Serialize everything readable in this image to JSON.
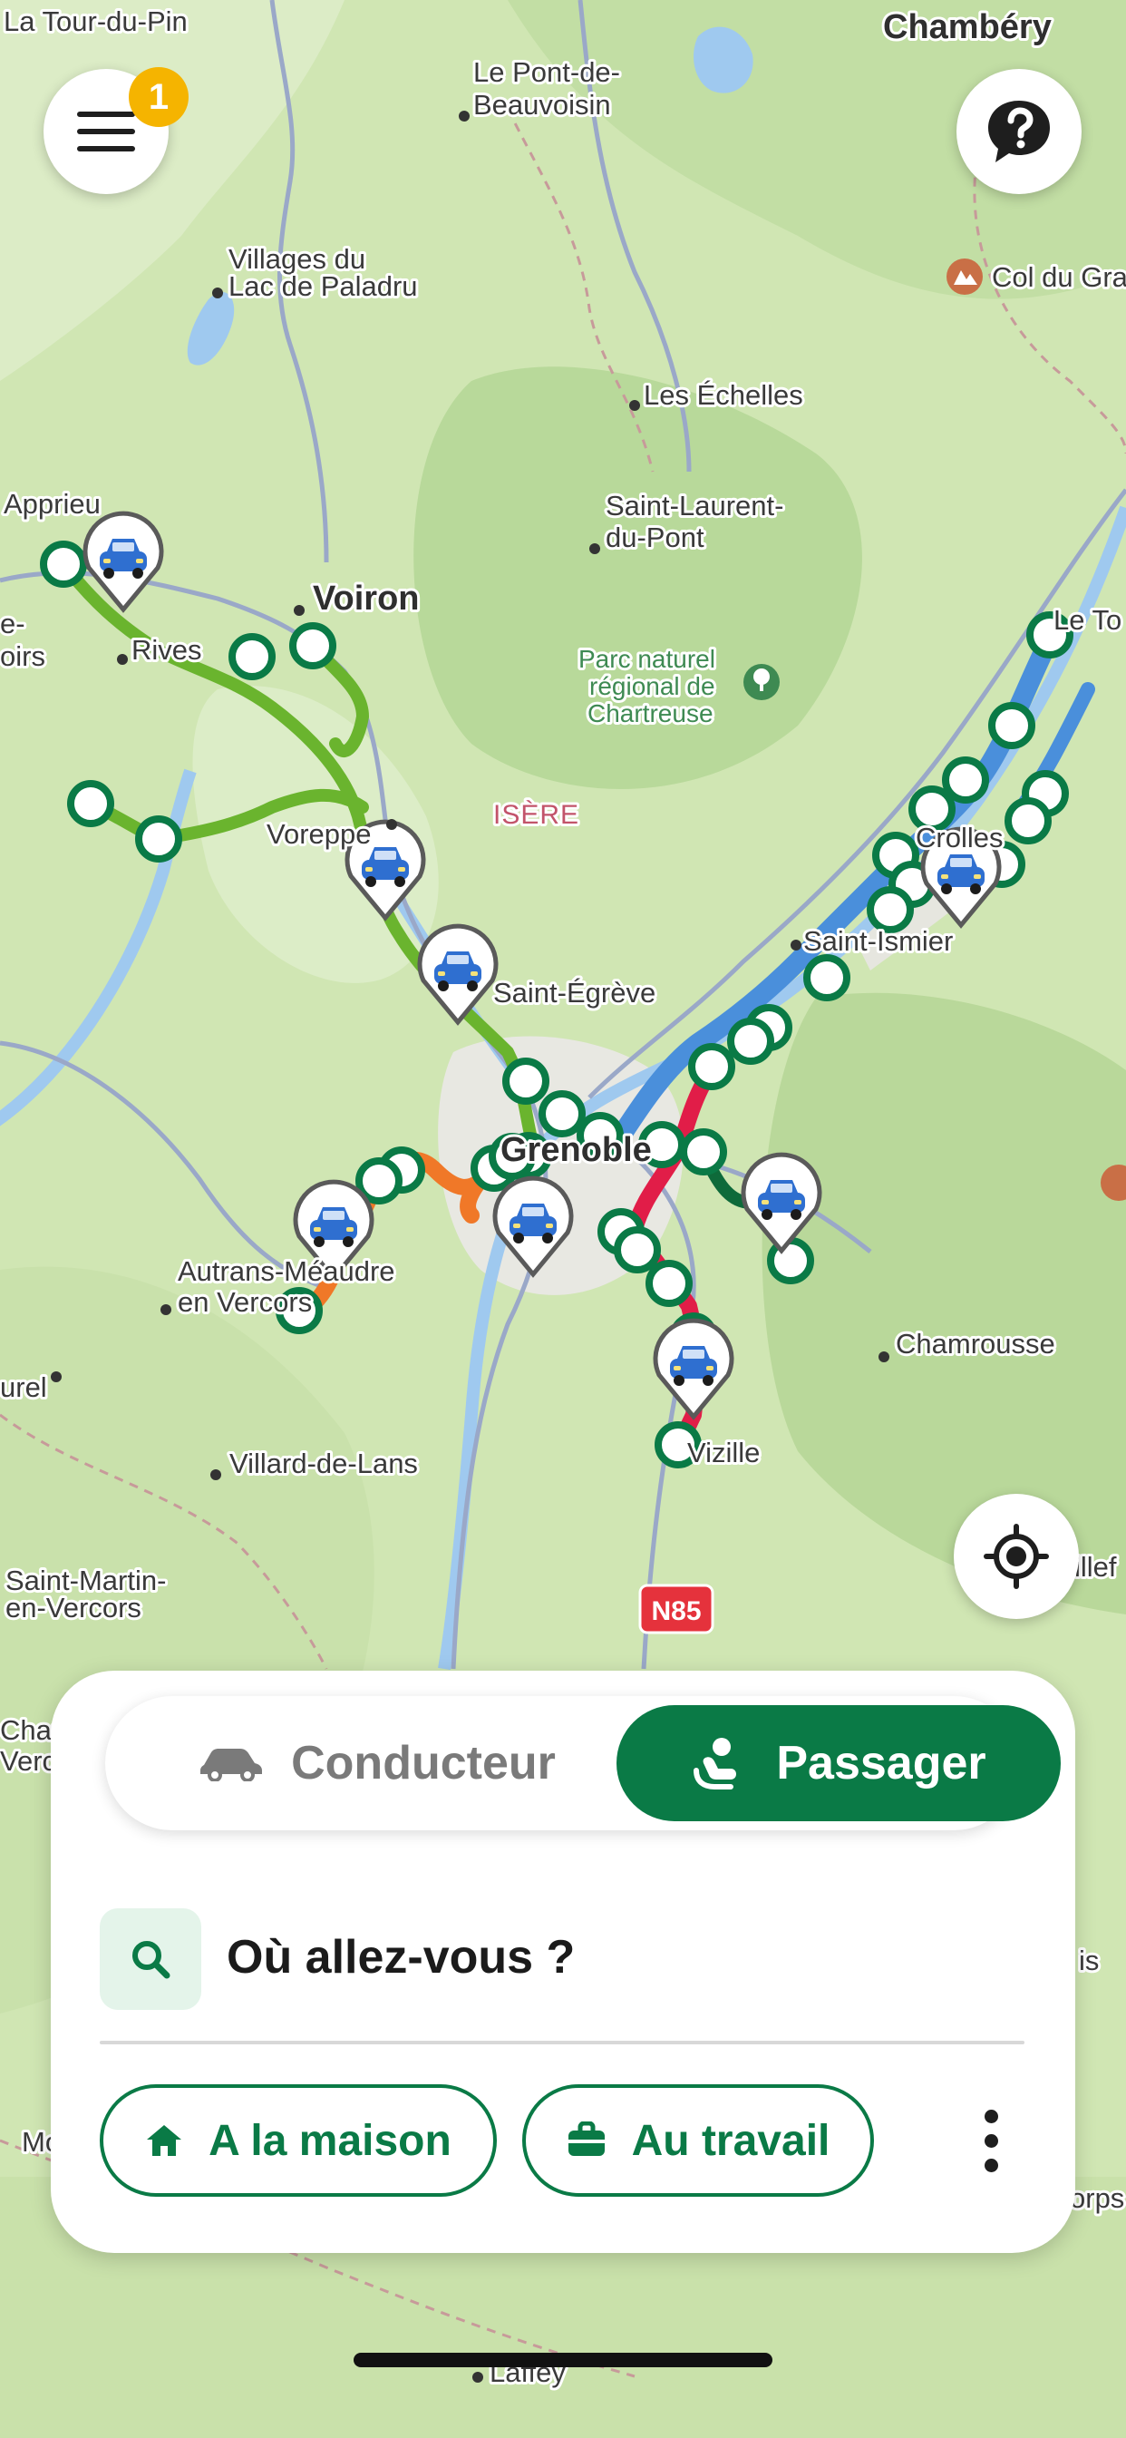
{
  "map": {
    "places": {
      "la_tour_du_pin": "La Tour-du-Pin",
      "chambery": "Chambéry",
      "pont_de_beauvoisin_1": "Le Pont-de-",
      "pont_de_beauvoisin_2": "Beauvoisin",
      "paladru_1": "Villages du",
      "paladru_2": "Lac de Paladru",
      "col_du_granier": "Col du Gra",
      "les_echelles": "Les Échelles",
      "st_laurent_1": "Saint-Laurent-",
      "st_laurent_2": "du-Pont",
      "apprieu": "Apprieu",
      "voiron": "Voiron",
      "rives": "Rives",
      "le_touvet": "Le To",
      "left_edge_1": "e-",
      "left_edge_2": "oirs",
      "chartreuse_1": "Parc naturel",
      "chartreuse_2": "régional de",
      "chartreuse_3": "Chartreuse",
      "isere": "ISÈRE",
      "voreppe": "Voreppe",
      "crolles": "Crolles",
      "saint_ismier": "Saint-Ismier",
      "saint_egreve": "Saint-Égrève",
      "grenoble": "Grenoble",
      "autrans_1": "Autrans-Méaudre",
      "autrans_2": "en Vercors",
      "chamrousse": "Chamrousse",
      "vizille": "Vizille",
      "villard": "Villard-de-Lans",
      "urel": "urel",
      "st_martin_1": "Saint-Martin-",
      "st_martin_2": "en-Vercors",
      "chap_1": "Chap",
      "chap_2": "Verc",
      "road_n85": "N85",
      "mo": "Mo",
      "is": "is",
      "orps": "orps",
      "allevard": "illef",
      "laffrey": "Laffey"
    },
    "colors": {
      "route_green_light": "#6ab42e",
      "route_green_dark": "#0e6a3a",
      "route_orange": "#f07828",
      "route_red": "#e11d48",
      "route_blue": "#4a8fdb",
      "stop_ring": "#0a7a46",
      "car_blue": "#2f6fd0"
    }
  },
  "header": {
    "notification_count": "1"
  },
  "panel": {
    "mode_driver": "Conducteur",
    "mode_passenger": "Passager",
    "active_mode": "passenger",
    "search_placeholder": "Où allez-vous ?",
    "shortcut_home": "A la maison",
    "shortcut_work": "Au travail"
  },
  "theme": {
    "primary": "#0a7a46",
    "badge": "#f5b400",
    "inactive_text": "#7a7a7a"
  }
}
